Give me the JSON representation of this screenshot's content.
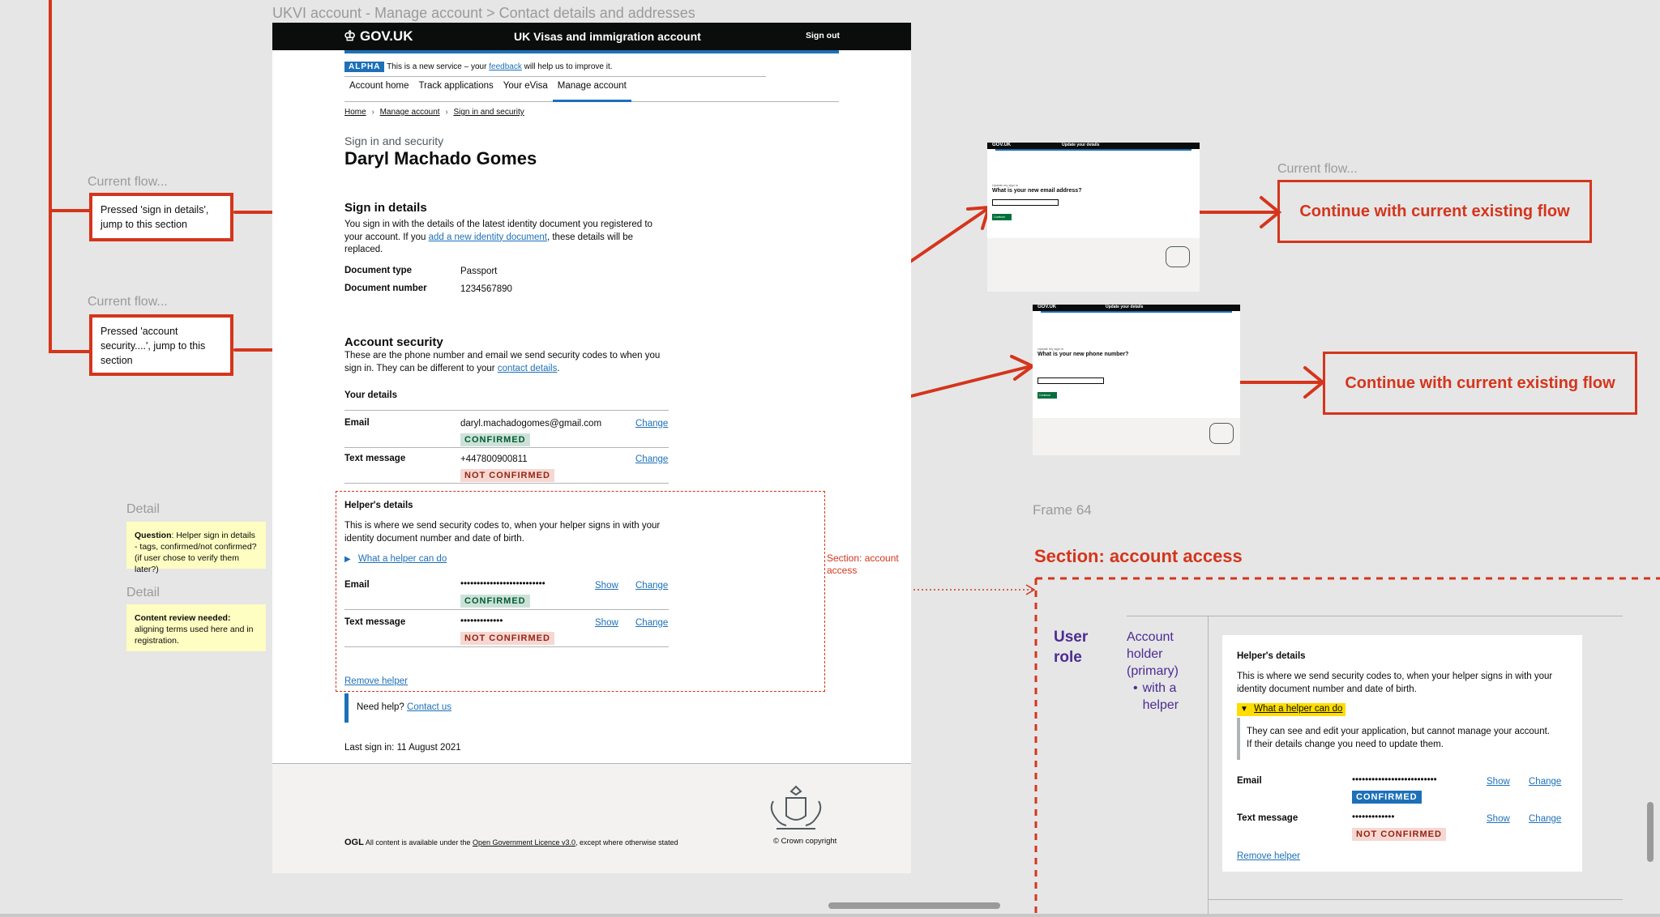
{
  "canvas": {
    "frame_title": "UKVI account - Manage account > Contact details and addresses",
    "frame64_label": "Frame 64",
    "section_dotted_label": "Section: account access",
    "section_heading": "Section: account access"
  },
  "annotations": {
    "current_flow_label": "Current flow...",
    "note_sign_in": "Pressed 'sign in details', jump to this section",
    "note_account_security": "Pressed 'account security....', jump to this section",
    "detail_label": "Detail",
    "sticky_question_bold": "Question",
    "sticky_question_text": ": Helper sign in details - tags, confirmed/not confirmed? (if user chose to verify them later?)",
    "sticky_review_bold": "Content review needed:",
    "sticky_review_text": " aligning terms used here and in registration.",
    "continue_flow": "Continue with current existing flow"
  },
  "page": {
    "logo": "GOV.UK",
    "service_name": "UK Visas and immigration account",
    "sign_out": "Sign out",
    "phase_tag": "ALPHA",
    "phase_text_before": "This is a new service – your ",
    "phase_link": "feedback",
    "phase_text_after": " will help us to improve it.",
    "nav": [
      "Account home",
      "Track applications",
      "Your eVisa",
      "Manage account"
    ],
    "breadcrumbs": [
      "Home",
      "Manage account",
      "Sign in and security"
    ],
    "caption": "Sign in and security",
    "title": "Daryl Machado Gomes",
    "sign_in": {
      "heading": "Sign in details",
      "body_before": "You sign in with the details of the latest identity document you registered to your account. If you ",
      "body_link": "add a new identity document",
      "body_after": ", these details will be replaced.",
      "doc_type_label": "Document type",
      "doc_type_value": "Passport",
      "doc_number_label": "Document number",
      "doc_number_value": "1234567890"
    },
    "security": {
      "heading": "Account security",
      "body_before": "These are the phone number and email we send security codes to when you sign in. They can be different to your ",
      "body_link": "contact details",
      "body_after": ".",
      "your_details": "Your details",
      "email_label": "Email",
      "email_value": "daryl.machadogomes@gmail.com",
      "email_tag": "CONFIRMED",
      "text_label": "Text message",
      "text_value": "+447800900811",
      "text_tag": "NOT CONFIRMED",
      "change": "Change"
    },
    "helper": {
      "heading": "Helper's details",
      "body": "This is where we send security codes to, when your helper signs in with your identity document number and date of birth.",
      "details_summary": "What a helper can do",
      "email_label": "Email",
      "email_value": "••••••••••••••••••••••••••",
      "email_tag": "CONFIRMED",
      "text_label": "Text message",
      "text_value": "•••••••••••••",
      "text_tag": "NOT CONFIRMED",
      "show": "Show",
      "change": "Change",
      "remove": "Remove helper"
    },
    "help_text": "Need help? ",
    "help_link": "Contact us",
    "last_sign_in": "Last sign in: 11 August 2021",
    "footer_ogl": "OGL",
    "footer_text_before": "All content is available under the ",
    "footer_link": "Open Government Licence v3.0",
    "footer_text_after": ", except where otherwise stated",
    "copyright": "© Crown copyright"
  },
  "thumb_email": {
    "logo": "GOV.UK",
    "service": "Update your details",
    "caption": "Update my sign in",
    "question": "What is your new email address?",
    "button": "Continue"
  },
  "thumb_phone": {
    "logo": "GOV.UK",
    "service": "Update your details",
    "caption": "Update my sign in",
    "question": "What is your new phone number?",
    "button": "Continue"
  },
  "access": {
    "role_heading": "User role",
    "role_name": "Account holder (primary)",
    "role_bullet": "with a helper",
    "card": {
      "heading": "Helper's details",
      "body": "This is where we send security codes to, when your helper signs in with your identity document number and date of birth.",
      "summary": "What a helper can do",
      "details_text": "They can see and edit your application, but cannot manage your account. If their details change you need to update them.",
      "email_label": "Email",
      "email_value": "••••••••••••••••••••••••••",
      "email_tag": "CONFIRMED",
      "text_label": "Text message",
      "text_value": "•••••••••••••",
      "text_tag": "NOT CONFIRMED",
      "show": "Show",
      "change": "Change",
      "remove": "Remove helper"
    }
  },
  "colors": {
    "annotation_red": "#d4351c",
    "govuk_blue": "#1d70b8",
    "purple": "#4c2c92"
  }
}
